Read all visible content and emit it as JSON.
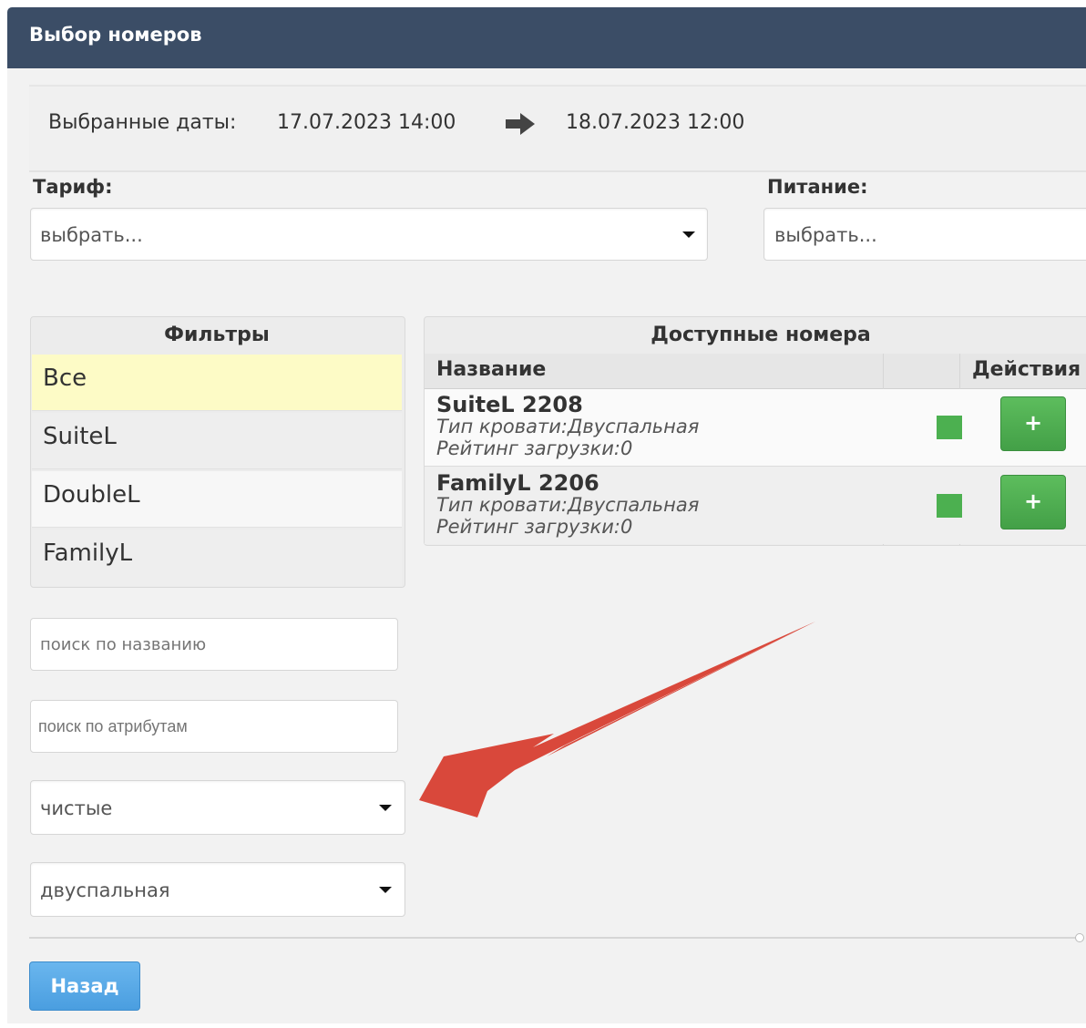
{
  "header": {
    "title": "Выбор номеров"
  },
  "dates": {
    "label": "Выбранные даты:",
    "from": "17.07.2023 14:00",
    "to": "18.07.2023 12:00"
  },
  "tariff": {
    "label": "Тариф:",
    "value": "выбрать..."
  },
  "meals": {
    "label": "Питание:",
    "value": "выбрать..."
  },
  "filters": {
    "title": "Фильтры",
    "items": [
      {
        "label": "Все",
        "selected": true
      },
      {
        "label": "SuiteL"
      },
      {
        "label": "DoubleL"
      },
      {
        "label": "FamilyL"
      }
    ],
    "search_name_placeholder": "поиск по названию",
    "search_attr_placeholder": "поиск по атрибутам",
    "cleanliness_value": "чистые",
    "bed_value": "двуспальная"
  },
  "rooms": {
    "title": "Доступные номера",
    "col_name": "Название",
    "col_actions": "Действия",
    "rows": [
      {
        "name": "SuiteL 2208",
        "bed": "Тип кровати:Двуспальная",
        "rating": "Рейтинг загрузки:0",
        "add_label": "+"
      },
      {
        "name": "FamilyL 2206",
        "bed": "Тип кровати:Двуспальная",
        "rating": "Рейтинг загрузки:0",
        "add_label": "+"
      }
    ]
  },
  "footer": {
    "back_label": "Назад"
  },
  "colors": {
    "header": "#3b4d66",
    "add_button": "#4cae4c",
    "back_button": "#5aa9e6",
    "selected_filter": "#fdfbc6",
    "annotation_arrow": "#d9483b"
  }
}
